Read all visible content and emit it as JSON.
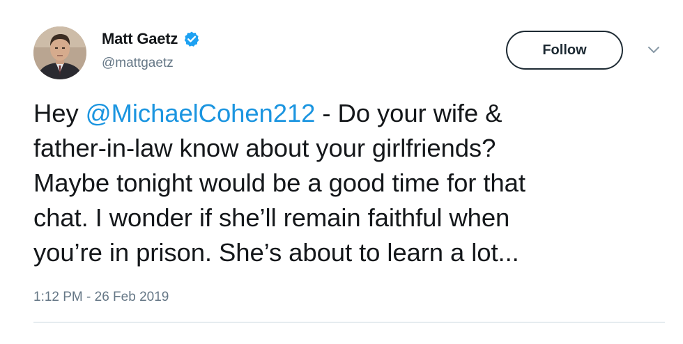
{
  "user": {
    "display_name": "Matt Gaetz",
    "handle": "@mattgaetz",
    "verified": true,
    "avatar_icon": "profile-photo"
  },
  "actions": {
    "follow_label": "Follow",
    "more_icon": "chevron-down-icon"
  },
  "tweet": {
    "text_lines": [
      {
        "before": "Hey ",
        "mention": "@MichaelCohen212",
        "after": " - Do your wife &"
      },
      {
        "text": "father-in-law know about your girlfriends?"
      },
      {
        "text": "Maybe tonight would be a good time for that"
      },
      {
        "text": "chat. I wonder if she’ll remain faithful when"
      },
      {
        "text": "you’re in prison.  She’s about to learn a lot..."
      }
    ],
    "timestamp": "1:12 PM - 26 Feb 2019"
  },
  "colors": {
    "mention": "#1b95e0",
    "verified_badge": "#1da1f2",
    "secondary_text": "#657786",
    "primary_text": "#14171a"
  }
}
